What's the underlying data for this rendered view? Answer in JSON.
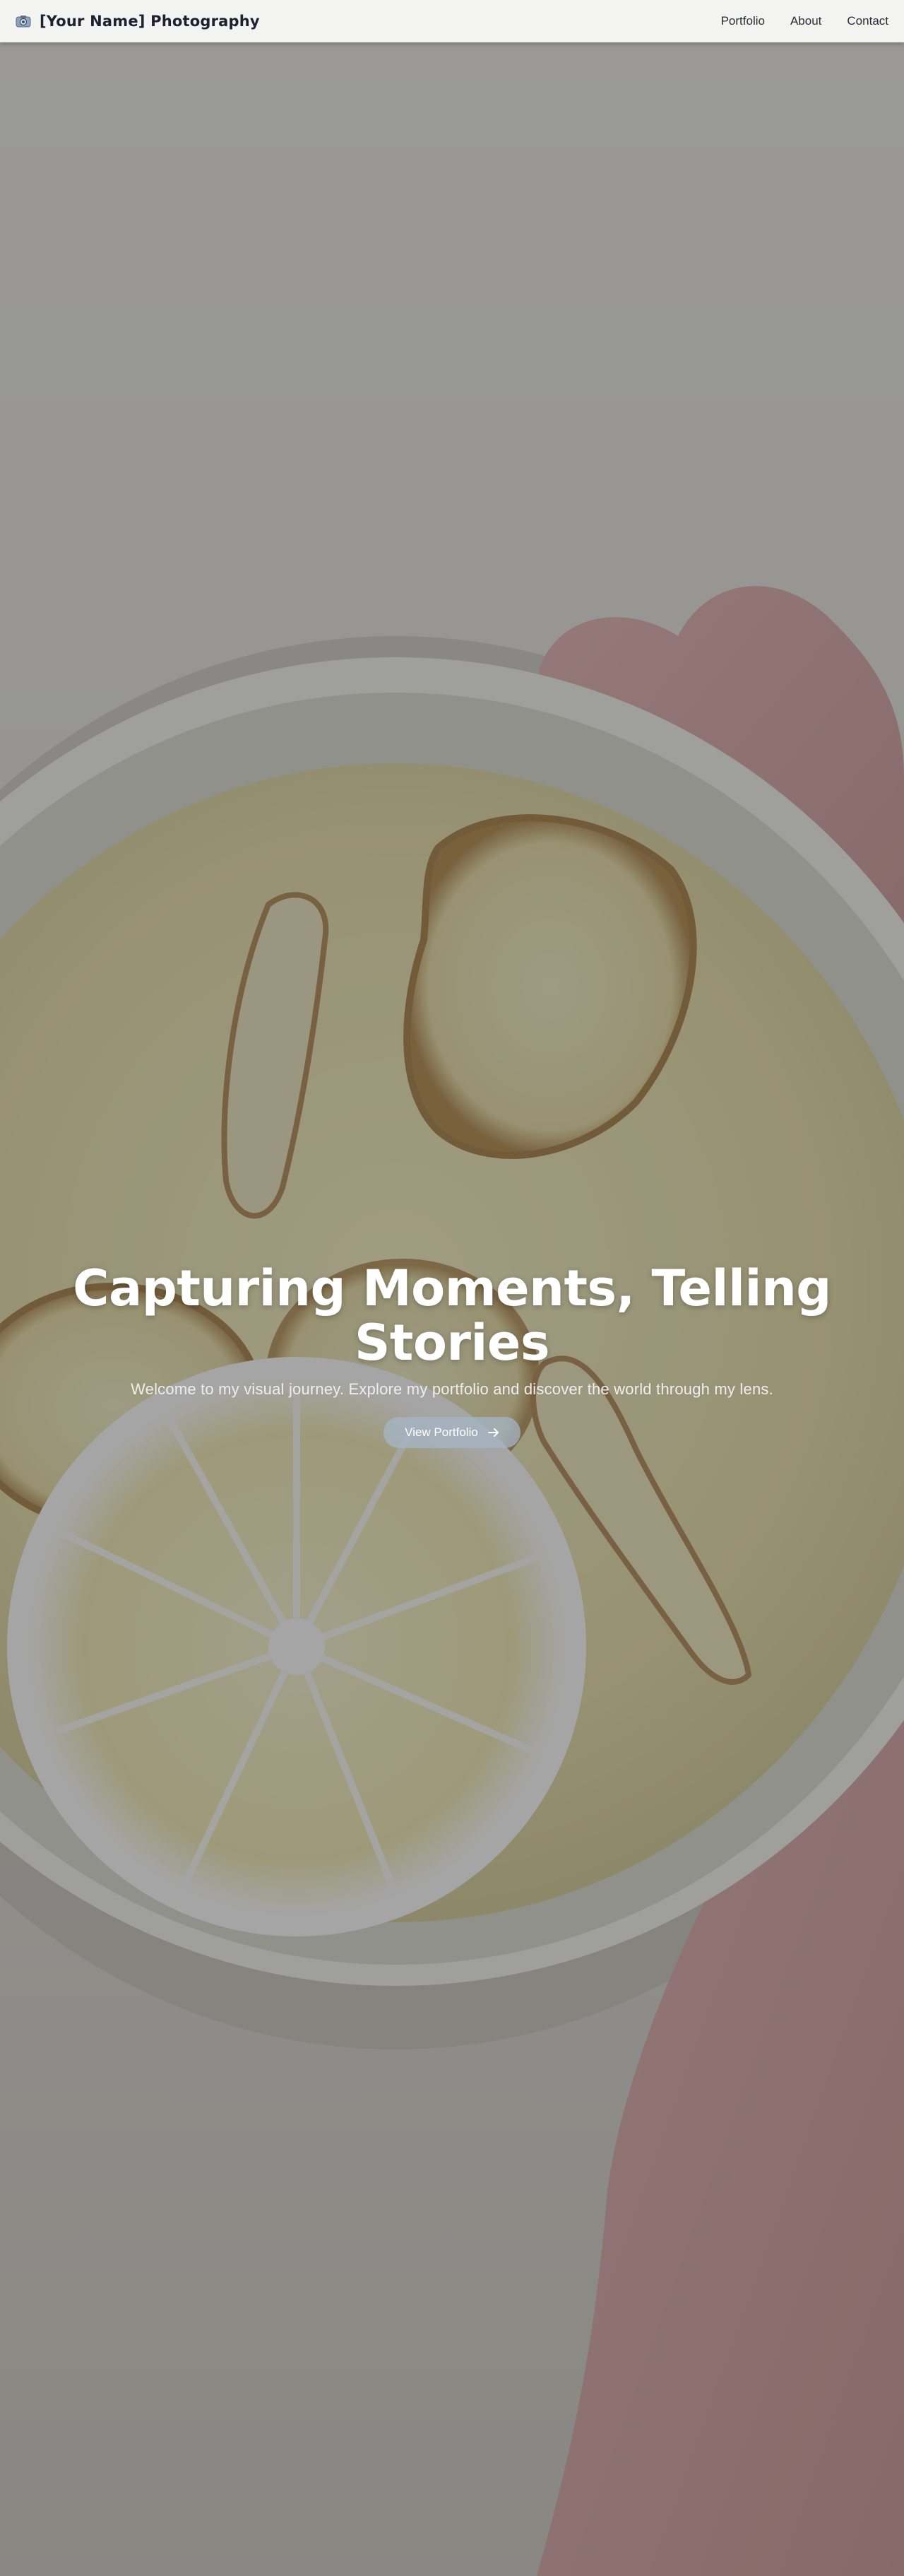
{
  "header": {
    "brand_name": "[Your Name] Photography",
    "brand_icon": "camera-icon",
    "nav": [
      {
        "label": "Portfolio"
      },
      {
        "label": "About"
      },
      {
        "label": "Contact"
      }
    ]
  },
  "hero": {
    "title": "Capturing Moments, Telling Stories",
    "subtitle": "Welcome to my visual journey. Explore my portfolio and discover the world through my lens.",
    "cta_label": "View Portfolio",
    "cta_icon": "arrow-right-icon"
  },
  "colors": {
    "header_bg": "#f3f3f2",
    "brand_text": "#1d2130",
    "cta_bg": "#a5b6c6",
    "overlay": "#282828"
  }
}
